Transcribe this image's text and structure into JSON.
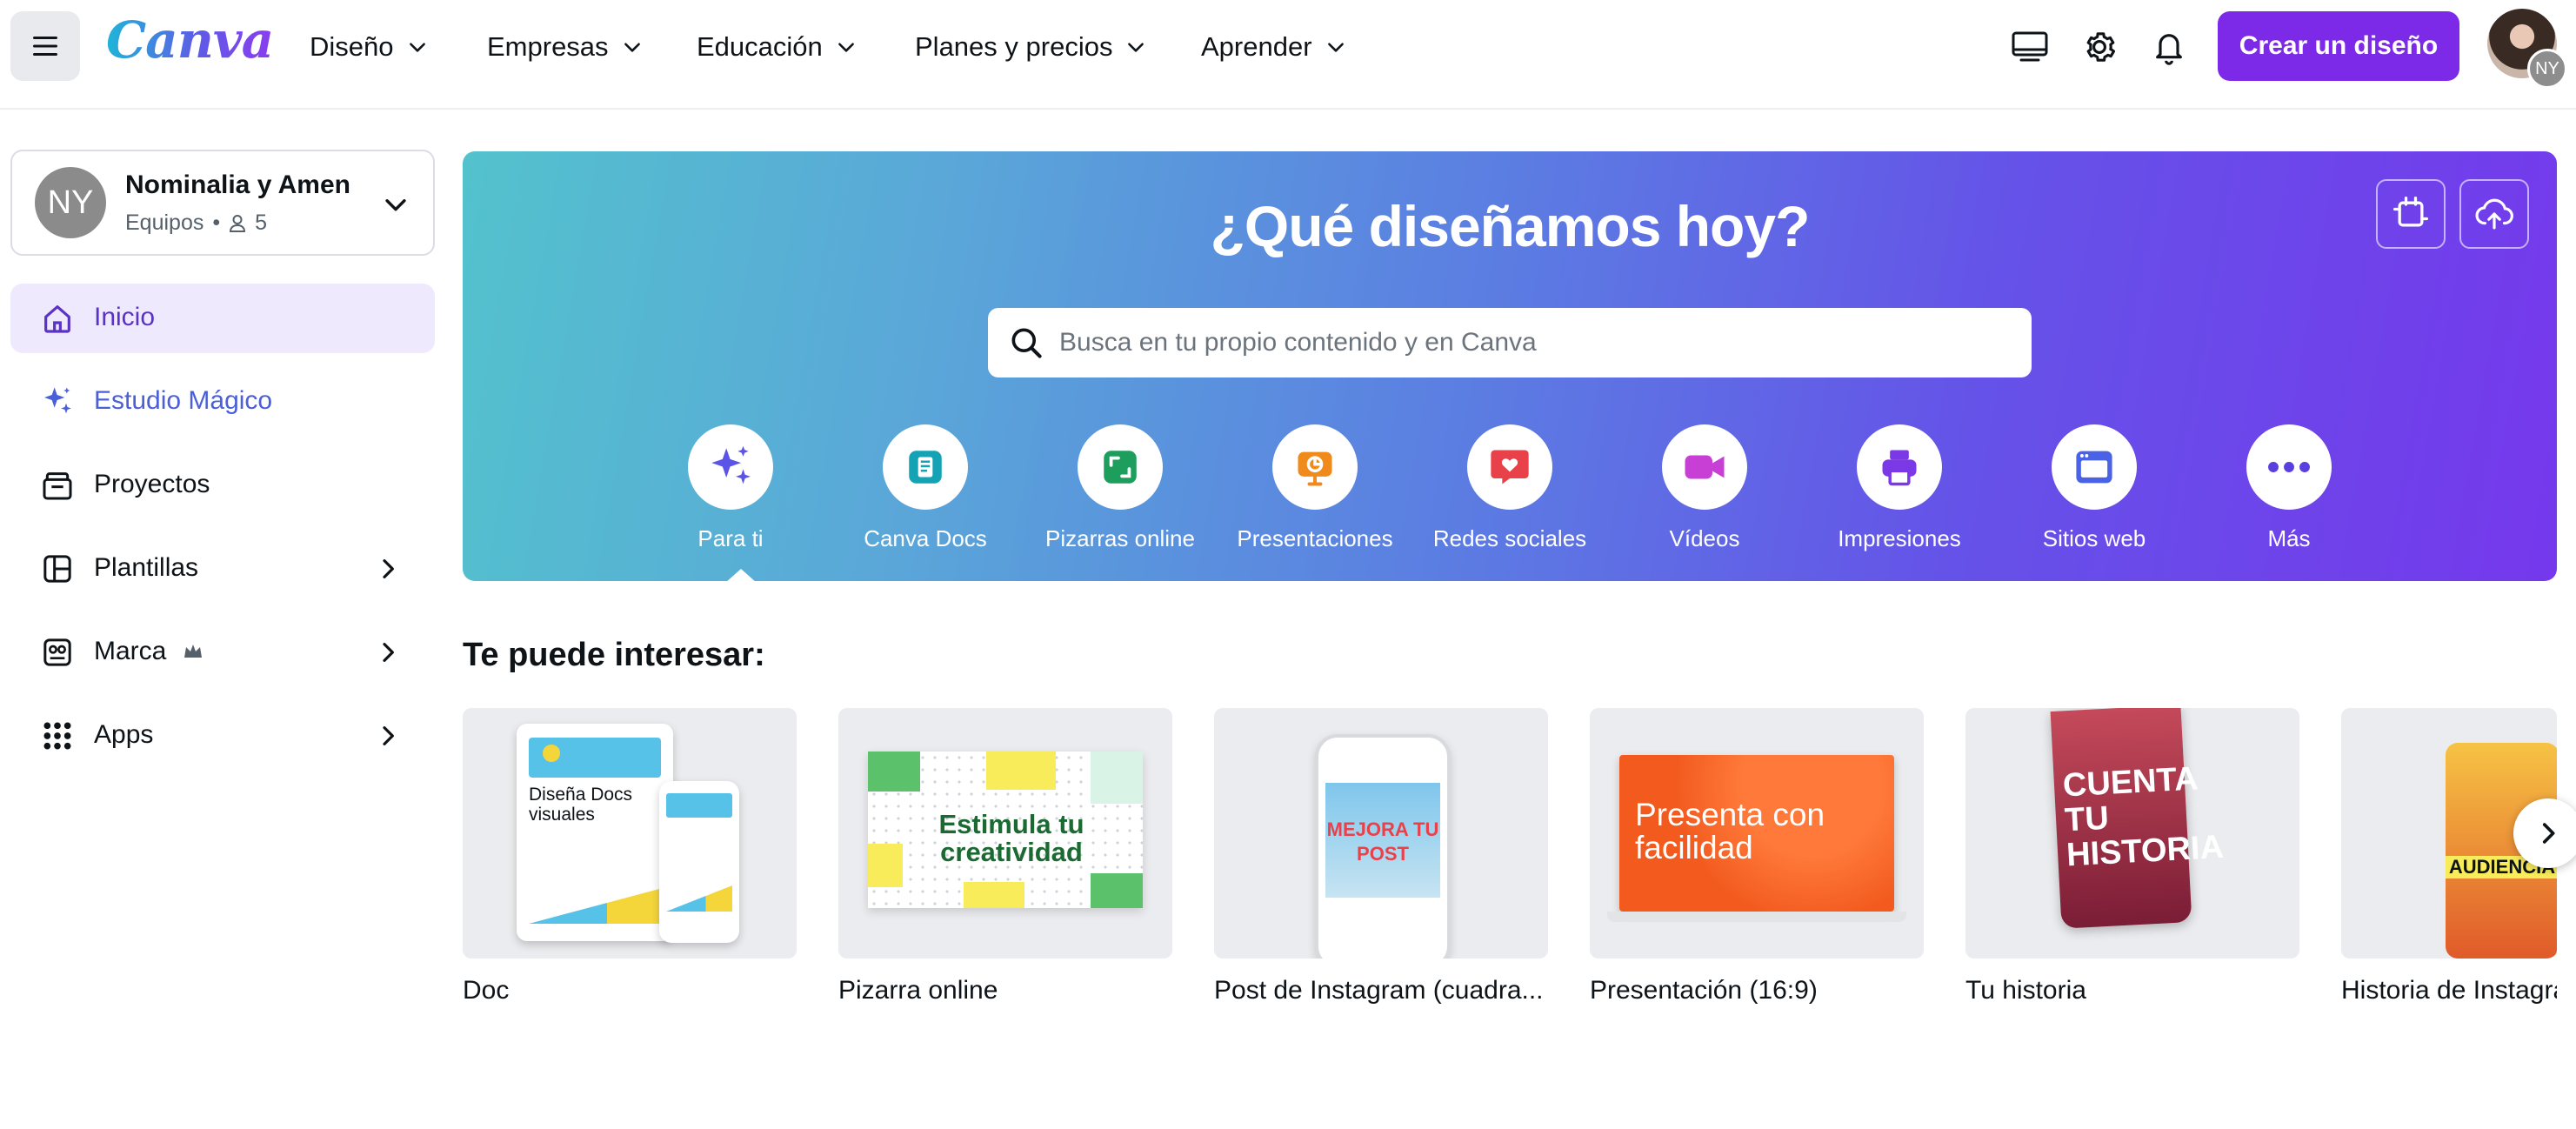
{
  "topbar": {
    "logo": "Canva",
    "nav": [
      {
        "label": "Diseño"
      },
      {
        "label": "Empresas"
      },
      {
        "label": "Educación"
      },
      {
        "label": "Planes y precios"
      },
      {
        "label": "Aprender"
      }
    ],
    "create_label": "Crear un diseño",
    "avatar_initials": "NY"
  },
  "sidebar": {
    "team": {
      "initials": "NY",
      "name": "Nominalia y Amen",
      "type": "Equipos",
      "members": "5"
    },
    "items": [
      {
        "label": "Inicio",
        "icon": "home-icon"
      },
      {
        "label": "Estudio Mágico",
        "icon": "sparkle-icon"
      },
      {
        "label": "Proyectos",
        "icon": "folder-icon"
      },
      {
        "label": "Plantillas",
        "icon": "template-icon"
      },
      {
        "label": "Marca",
        "icon": "brand-icon"
      },
      {
        "label": "Apps",
        "icon": "apps-grid-icon"
      }
    ]
  },
  "hero": {
    "title": "¿Qué diseñamos hoy?",
    "search_placeholder": "Busca en tu propio contenido y en Canva",
    "categories": [
      {
        "label": "Para ti"
      },
      {
        "label": "Canva Docs"
      },
      {
        "label": "Pizarras online"
      },
      {
        "label": "Presentaciones"
      },
      {
        "label": "Redes sociales"
      },
      {
        "label": "Vídeos"
      },
      {
        "label": "Impresiones"
      },
      {
        "label": "Sitios web"
      },
      {
        "label": "Más"
      }
    ]
  },
  "suggestions": {
    "title": "Te puede interesar:",
    "cards": [
      {
        "label": "Doc",
        "thumb_text": "Diseña Docs visuales"
      },
      {
        "label": "Pizarra online",
        "thumb_text": "Estimula tu creatividad"
      },
      {
        "label": "Post de Instagram (cuadra...",
        "thumb_text": "MEJORA TU POST"
      },
      {
        "label": "Presentación (16:9)",
        "thumb_text": "Presenta con facilidad"
      },
      {
        "label": "Tu historia",
        "thumb_text": "CUENTA TU HISTORIA"
      },
      {
        "label": "Historia de Instagram",
        "thumb_text": "AUDIENCIA"
      }
    ]
  },
  "colors": {
    "accent": "#7d2ae8",
    "active_bg": "#efe9fd",
    "active_text": "#5a32c6"
  }
}
